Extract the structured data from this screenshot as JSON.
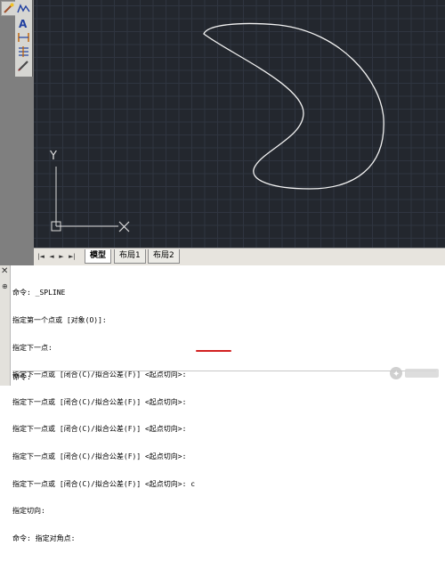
{
  "toolbar": {
    "tools": [
      "polyline-icon",
      "text-icon",
      "dimension-icon",
      "multiline-icon",
      "pencil-icon"
    ]
  },
  "viewport": {
    "ucs": {
      "y_label": "Y"
    }
  },
  "tabs": {
    "nav": [
      "|◄",
      "◄",
      "►",
      "►|"
    ],
    "items": [
      {
        "label": "模型",
        "active": true
      },
      {
        "label": "布局1",
        "active": false
      },
      {
        "label": "布局2",
        "active": false
      }
    ]
  },
  "command": {
    "lines": [
      "命令: _SPLINE",
      "指定第一个点或 [对象(O)]:",
      "指定下一点:",
      "指定下一点或 [闭合(C)/拟合公差(F)] <起点切向>:",
      "指定下一点或 [闭合(C)/拟合公差(F)] <起点切向>:",
      "指定下一点或 [闭合(C)/拟合公差(F)] <起点切向>:",
      "指定下一点或 [闭合(C)/拟合公差(F)] <起点切向>:",
      "指定下一点或 [闭合(C)/拟合公差(F)] <起点切向>: c",
      "指定切向:",
      "命令: 指定对角点:"
    ],
    "prompt": "命令:",
    "marker_color": "#d22020"
  }
}
